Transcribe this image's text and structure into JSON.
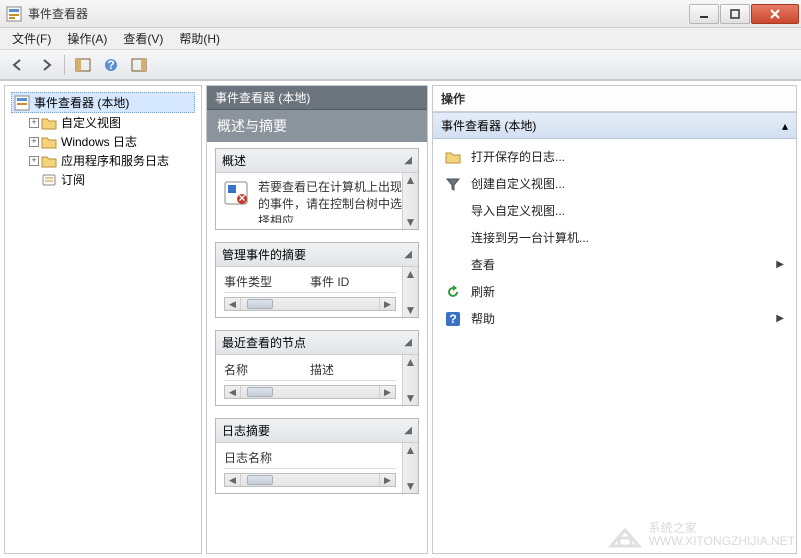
{
  "window": {
    "title": "事件查看器"
  },
  "menubar": {
    "file": "文件(F)",
    "action": "操作(A)",
    "view": "查看(V)",
    "help": "帮助(H)"
  },
  "tree": {
    "root": "事件查看器 (本地)",
    "items": [
      {
        "label": "自定义视图",
        "expandable": true
      },
      {
        "label": "Windows 日志",
        "expandable": true
      },
      {
        "label": "应用程序和服务日志",
        "expandable": true
      },
      {
        "label": "订阅",
        "expandable": false
      }
    ]
  },
  "mid": {
    "header": "事件查看器 (本地)",
    "title": "概述与摘要",
    "overview": {
      "label": "概述",
      "text": "若要查看已在计算机上出现的事件，请在控制台树中选择相应"
    },
    "summary": {
      "label": "管理事件的摘要",
      "col1": "事件类型",
      "col2": "事件 ID"
    },
    "recent": {
      "label": "最近查看的节点",
      "col1": "名称",
      "col2": "描述"
    },
    "logsummary": {
      "label": "日志摘要",
      "col1": "日志名称"
    }
  },
  "actions": {
    "pane_title": "操作",
    "section": "事件查看器 (本地)",
    "items": {
      "open_saved": "打开保存的日志...",
      "create_view": "创建自定义视图...",
      "import_view": "导入自定义视图...",
      "connect": "连接到另一台计算机...",
      "view": "查看",
      "refresh": "刷新",
      "help": "帮助"
    }
  },
  "watermark": {
    "line1": "系统之家",
    "line2": "WWW.XITONGZHIJIA.NET"
  }
}
